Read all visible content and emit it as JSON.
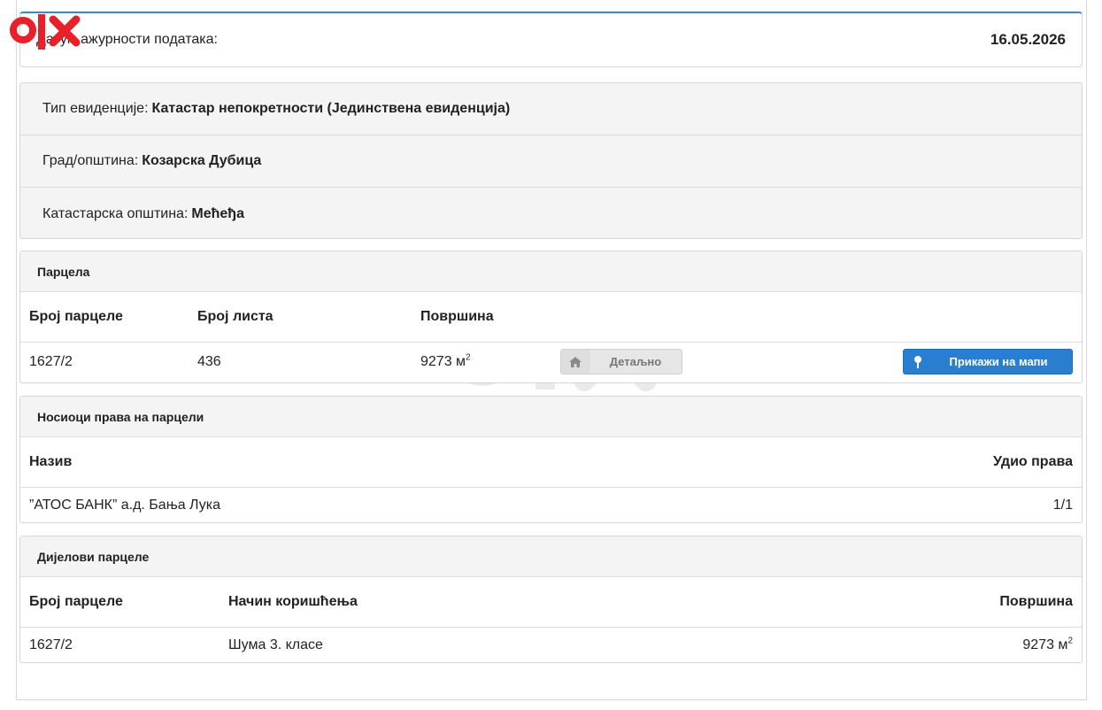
{
  "logo": {
    "text": "olx",
    "color": "#e8202a"
  },
  "update": {
    "label": "Датум ажурности података:",
    "value": "16.05.2026"
  },
  "info": {
    "type_label": "Тип евиденције:",
    "type_value": "Катастар непокретности (Јединствена евиденција)",
    "city_label": "Град/општина:",
    "city_value": "Козарска Дубица",
    "cadastral_label": "Катастарска општина:",
    "cadastral_value": "Мећеђа"
  },
  "parcel": {
    "title": "Парцела",
    "headers": {
      "number": "Број парцеле",
      "sheet": "Број листа",
      "area": "Површина"
    },
    "row": {
      "number": "1627/2",
      "sheet": "436",
      "area": "9273 м",
      "area_unit_exp": "2"
    },
    "detail_button": "Детаљно",
    "map_button": "Прикажи на мапи"
  },
  "holders": {
    "title": "Носиоци права на парцели",
    "headers": {
      "name": "Назив",
      "share": "Удио права"
    },
    "rows": [
      {
        "name": "”АТОС БАНК” а.д. Бања Лука",
        "share": "1/1"
      }
    ]
  },
  "parts": {
    "title": "Дијелови парцеле",
    "headers": {
      "number": "Број парцеле",
      "usage": "Начин коришћења",
      "area": "Површина"
    },
    "rows": [
      {
        "number": "1627/2",
        "usage": "Шума 3. класе",
        "area": "9273 м",
        "area_unit_exp": "2"
      }
    ]
  },
  "colors": {
    "accent": "#2a7ed0",
    "brand": "#e8202a"
  }
}
